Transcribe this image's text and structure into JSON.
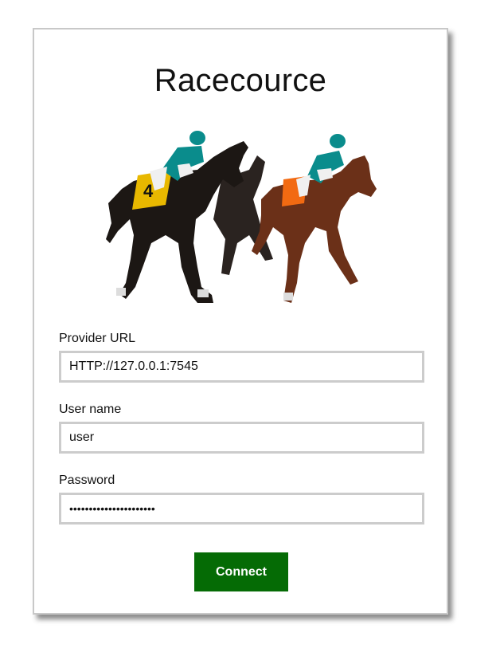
{
  "app": {
    "title": "Racecource"
  },
  "form": {
    "provider_url": {
      "label": "Provider URL",
      "value": "HTTP://127.0.0.1:7545"
    },
    "username": {
      "label": "User name",
      "value": "user"
    },
    "password": {
      "label": "Password",
      "value": "••••••••••••••••••••••"
    },
    "connect_label": "Connect"
  },
  "colors": {
    "button_bg": "#056b05",
    "input_border": "#cccccc",
    "card_border": "#c8c8c8",
    "jockey_silks": "#0a8c8c",
    "horse_dark": "#1c1714",
    "horse_bay": "#6b3018",
    "saddle_cloth_yellow": "#e8b800",
    "saddle_cloth_orange": "#f26a12"
  },
  "hero_image": {
    "icon": "racehorses-illustration"
  }
}
